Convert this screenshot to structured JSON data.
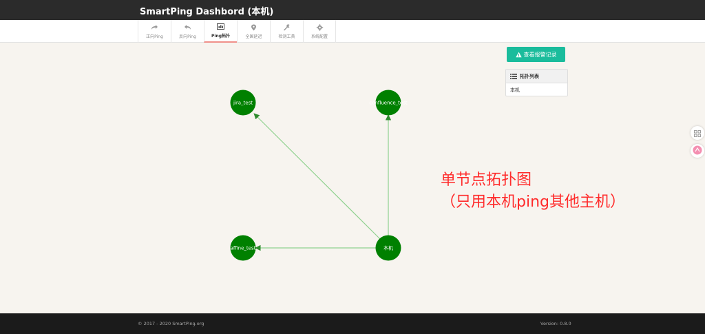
{
  "app": {
    "title": "SmartPing Dashbord (本机)"
  },
  "nav": {
    "tabs": [
      {
        "label": "正向Ping",
        "icon": "share-icon"
      },
      {
        "label": "反向Ping",
        "icon": "reply-icon"
      },
      {
        "label": "Ping拓扑",
        "icon": "bar-chart-icon",
        "active": true
      },
      {
        "label": "全国延迟",
        "icon": "map-marker-icon"
      },
      {
        "label": "检测工具",
        "icon": "wrench-icon"
      },
      {
        "label": "系统配置",
        "icon": "gear-icon"
      }
    ]
  },
  "alarm_button": {
    "label": "查看报警记录",
    "icon": "warning-icon",
    "color": "#1abc9c"
  },
  "topology_panel": {
    "title": "拓扑列表",
    "items": [
      "本机"
    ]
  },
  "topology": {
    "node_color": "#008000",
    "edge_color": "#8fd18f",
    "nodes": {
      "jira": "jira_test",
      "confluence": "confluence_test",
      "affine": "affine_test",
      "local": "本机"
    },
    "edges": [
      {
        "from": "本机",
        "to": "jira_test"
      },
      {
        "from": "本机",
        "to": "confluence_test"
      },
      {
        "from": "本机",
        "to": "affine_test"
      }
    ]
  },
  "annotation": {
    "line1": "单节点拓扑图",
    "line2": "（只用本机ping其他主机）",
    "color": "#ff2b2b"
  },
  "footer": {
    "copyright": "© 2017 - 2020 SmartPing.org",
    "version": "Version: 0.8.0"
  }
}
